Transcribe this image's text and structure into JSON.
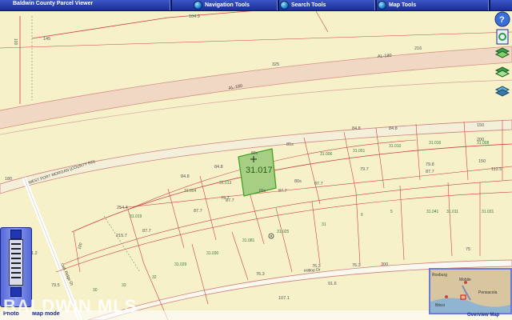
{
  "app": {
    "title": "Baldwin County Parcel Viewer",
    "menus": [
      {
        "label": "Navigation Tools"
      },
      {
        "label": "Search Tools"
      },
      {
        "label": "Map Tools"
      }
    ],
    "footer": {
      "photo": "Photo",
      "map_mode": "Map mode",
      "overview": "Overview Map"
    },
    "watermark": "BALDWIN MLS"
  },
  "map": {
    "roads": {
      "al180_upper": "AL-180",
      "al180_lower": "AL-180",
      "fort_morgan": "WEST FORT MORGAN (COUNTY RD)",
      "hilltop": "Hilltop Dr",
      "oak_ridge": "Oak Ridge Dr"
    },
    "selected_parcel": {
      "acres": "31.017",
      "top": "80s",
      "bottom": "80s"
    },
    "dimensions": {
      "d1048": "104.9",
      "d84a": "84.8",
      "d84b": "84.8",
      "d84c": "84.8",
      "d84d": "84.8",
      "d150a": "150",
      "d150b": "150",
      "d1125": "112.5",
      "d75": "75",
      "d798": "79.8",
      "d797a": "79.7",
      "d797b": "79.7",
      "d877a": "87.7",
      "d877b": "87.7",
      "d877c": "87.7",
      "d877d": "87.7",
      "d877e": "87.7",
      "d877f": "87.7",
      "d2544": "254.4",
      "d2157": "215.7",
      "d100a": "100",
      "d100b": "100",
      "d80s": "80s",
      "d85s": "85s",
      "d412": "41.2",
      "d795": "79.5",
      "d916": "91.6",
      "d1071": "107.1",
      "d763a": "76.3",
      "d763b": "76.3",
      "d763c": "76.3",
      "d145": "145",
      "d325": "325",
      "d216": "216",
      "d180": "180",
      "d200": "200",
      "d300": "300"
    },
    "lots": [
      "31.004",
      "31.013",
      "31.006",
      "31.001",
      "31.010",
      "31.016",
      "31.008",
      "31.019",
      "31.029",
      "31.030",
      "31.081",
      "32",
      "33",
      "31",
      "5",
      "6",
      "30",
      "31.025",
      "31.041",
      "31.011",
      "31.031"
    ],
    "overview_labels": {
      "a": "Roxburg",
      "b": "Mobile",
      "c": "Pensacola",
      "d": "Biloxi"
    }
  }
}
